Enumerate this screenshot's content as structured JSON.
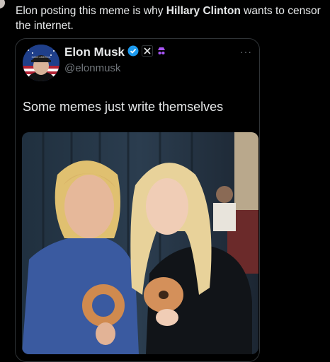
{
  "post": {
    "text_before": "Elon posting this meme is why ",
    "text_bold": "Hillary Clinton",
    "text_after": " wants to censor the internet."
  },
  "quote": {
    "display_name": "Elon Musk",
    "handle": "@elonmusk",
    "more_label": "···",
    "text": "Some memes just write themselves",
    "badges": [
      "verified-badge-icon",
      "x-affiliate-icon",
      "incognito-icon"
    ],
    "avatar_hat_text": "MAKE AMERICA"
  },
  "photo": {
    "description_hidden": ""
  },
  "colors": {
    "background": "#000000",
    "text": "#e7e9ea",
    "muted": "#71767b",
    "border": "#2f3336",
    "verified": "#1d9bf0",
    "accent_purple": "#a855f7"
  }
}
